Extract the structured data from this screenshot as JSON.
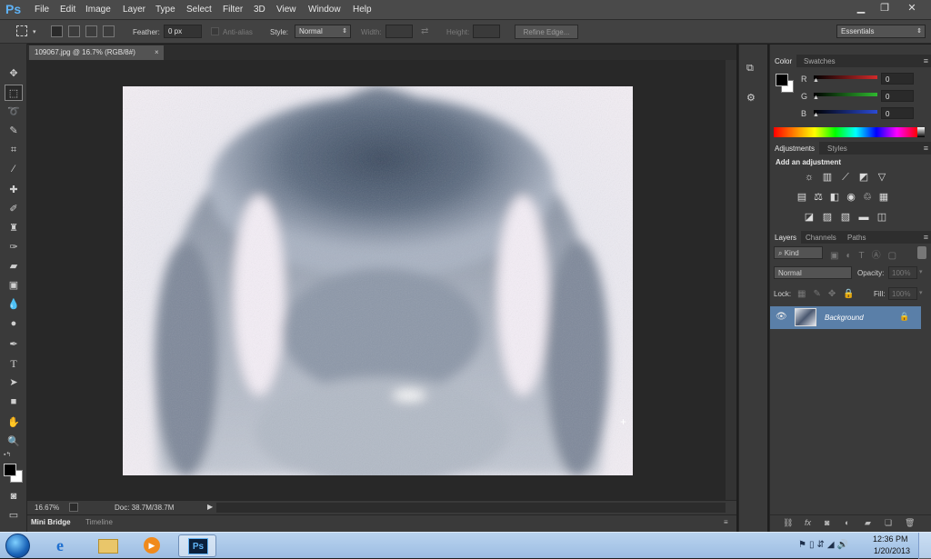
{
  "app": {
    "logo": "Ps"
  },
  "menubar": {
    "items": [
      "File",
      "Edit",
      "Image",
      "Layer",
      "Type",
      "Select",
      "Filter",
      "3D",
      "View",
      "Window",
      "Help"
    ],
    "window_controls": [
      "minimize-icon",
      "restore-icon",
      "close-icon"
    ]
  },
  "options_bar": {
    "feather_label": "Feather:",
    "feather_value": "0 px",
    "antialias_label": "Anti-alias",
    "style_label": "Style:",
    "style_value": "Normal",
    "width_label": "Width:",
    "height_label": "Height:",
    "refine_edge_label": "Refine Edge...",
    "workspace_value": "Essentials"
  },
  "document": {
    "tab_title": "109067.jpg @ 16.7% (RGB/8#)",
    "zoom": "16.67%",
    "doc_info": "Doc: 38.7M/38.7M"
  },
  "bottom_tabs": [
    "Mini Bridge",
    "Timeline"
  ],
  "color_panel": {
    "tabs": [
      "Color",
      "Swatches"
    ],
    "channels": [
      {
        "label": "R",
        "value": "0",
        "color": "#d12a2a"
      },
      {
        "label": "G",
        "value": "0",
        "color": "#2fb82f"
      },
      {
        "label": "B",
        "value": "0",
        "color": "#2b4bd6"
      }
    ]
  },
  "adjustments_panel": {
    "tabs": [
      "Adjustments",
      "Styles"
    ],
    "heading": "Add an adjustment"
  },
  "layers_panel": {
    "tabs": [
      "Layers",
      "Channels",
      "Paths"
    ],
    "filter_kind": "Kind",
    "blend_mode": "Normal",
    "opacity_label": "Opacity:",
    "opacity_value": "100%",
    "lock_label": "Lock:",
    "fill_label": "Fill:",
    "fill_value": "100%",
    "layers": [
      {
        "name": "Background",
        "visible": true,
        "locked": true
      }
    ]
  },
  "taskbar": {
    "time": "12:36 PM",
    "date": "1/20/2013",
    "apps": [
      "start-orb",
      "internet-explorer",
      "windows-explorer",
      "media-player",
      "photoshop"
    ]
  },
  "colors": {
    "accent_blue": "#5fb2f5",
    "panel_bg": "#3a3a3a",
    "canvas_bg": "#282828"
  }
}
